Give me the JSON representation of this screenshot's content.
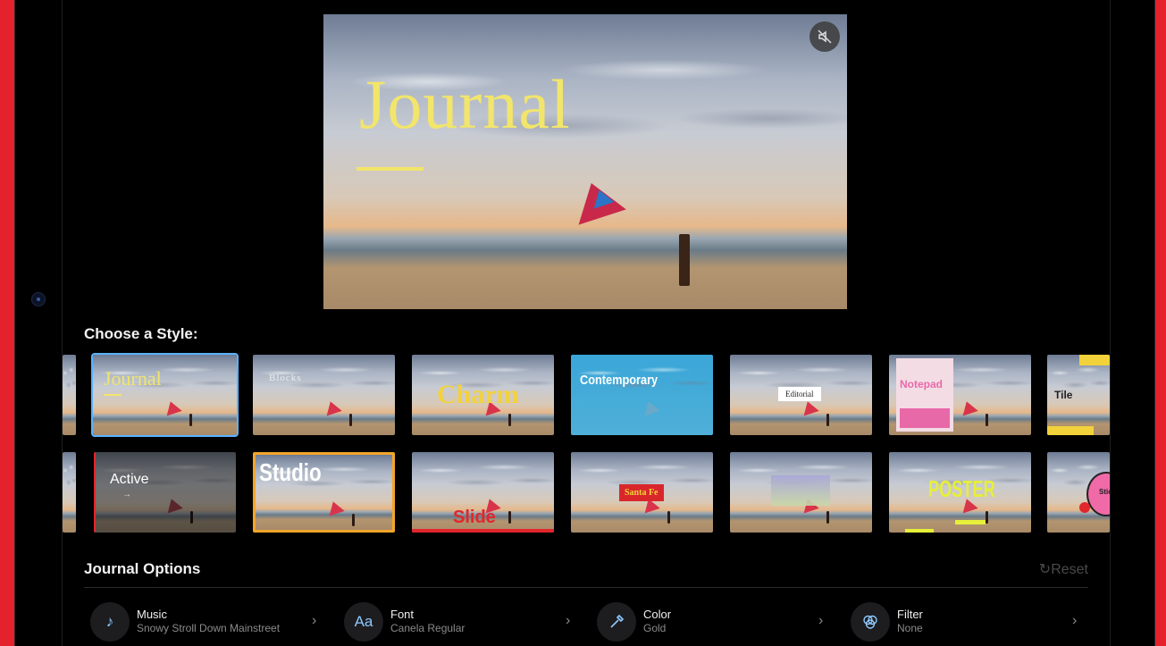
{
  "preview": {
    "title": "Journal"
  },
  "style_section": {
    "label": "Choose a Style:"
  },
  "styles_row1": [
    "Journal",
    "Blocks",
    "Charm",
    "Contemporary",
    "Editorial",
    "Notepad",
    "Tile"
  ],
  "styles_row2": [
    "Active",
    "Studio",
    "Slide",
    "Santa Fe",
    "",
    "POSTER",
    "Stic"
  ],
  "options": {
    "title": "Journal Options",
    "reset_label": "Reset",
    "items": [
      {
        "name": "Music",
        "value": "Snowy Stroll Down Mainstreet",
        "icon": "music-note-icon"
      },
      {
        "name": "Font",
        "value": "Canela Regular",
        "icon": "font-aa-icon",
        "glyph": "Aa"
      },
      {
        "name": "Color",
        "value": "Gold",
        "icon": "eyedropper-icon"
      },
      {
        "name": "Filter",
        "value": "None",
        "icon": "filter-circles-icon"
      }
    ]
  },
  "colors": {
    "selected_outline": "#5ab2ff",
    "journal_yellow": "#f2e56b",
    "studio_orange": "#f4a52a",
    "contemporary_blue": "#3aa6d8",
    "slide_red": "#e2262b"
  }
}
